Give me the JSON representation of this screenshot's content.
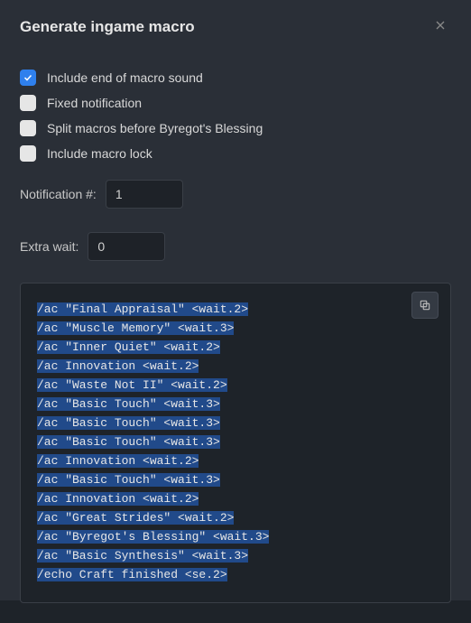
{
  "dialog": {
    "title": "Generate ingame macro"
  },
  "checkboxes": [
    {
      "label": "Include end of macro sound",
      "checked": true
    },
    {
      "label": "Fixed notification",
      "checked": false
    },
    {
      "label": "Split macros before Byregot's Blessing",
      "checked": false
    },
    {
      "label": "Include macro lock",
      "checked": false
    }
  ],
  "fields": {
    "notification": {
      "label": "Notification #:",
      "value": "1"
    },
    "extrawait": {
      "label": "Extra wait:",
      "value": "0"
    }
  },
  "macro_lines": [
    "/ac \"Final Appraisal\" <wait.2>",
    "/ac \"Muscle Memory\" <wait.3>",
    "/ac \"Inner Quiet\" <wait.2>",
    "/ac Innovation <wait.2>",
    "/ac \"Waste Not II\" <wait.2>",
    "/ac \"Basic Touch\" <wait.3>",
    "/ac \"Basic Touch\" <wait.3>",
    "/ac \"Basic Touch\" <wait.3>",
    "/ac Innovation <wait.2>",
    "/ac \"Basic Touch\" <wait.3>",
    "/ac Innovation <wait.2>",
    "/ac \"Great Strides\" <wait.2>",
    "/ac \"Byregot's Blessing\" <wait.3>",
    "/ac \"Basic Synthesis\" <wait.3>",
    "/echo Craft finished <se.2>"
  ]
}
